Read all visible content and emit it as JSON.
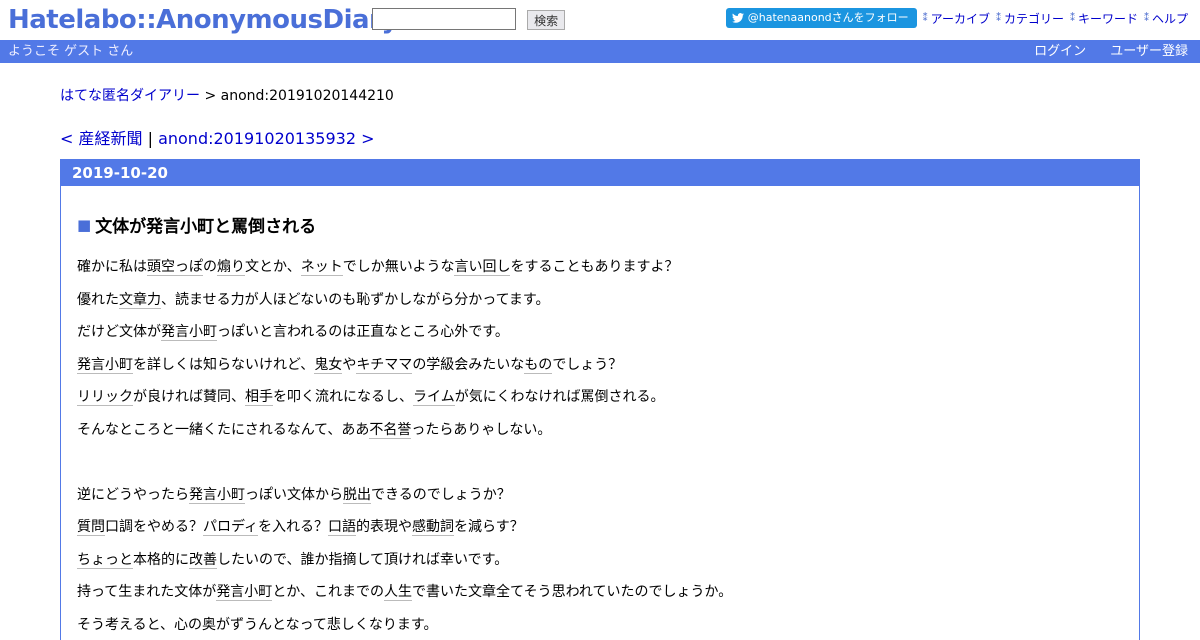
{
  "header": {
    "logo": "Hatelabo::AnonymousDiary",
    "search": {
      "placeholder": "",
      "value": "",
      "button_label": "検索"
    },
    "twitter_follow": "@hatenaanondさんをフォロー",
    "nav": [
      "アーカイブ",
      "カテゴリー",
      "キーワード",
      "ヘルプ"
    ]
  },
  "bar": {
    "welcome": "ようこそ ゲスト さん",
    "login": "ログイン",
    "register": "ユーザー登録"
  },
  "breadcrumb": {
    "root": "はてな匿名ダイアリー",
    "separator": " > ",
    "current": "anond:20191020144210"
  },
  "prevnext": {
    "prev": "< 産経新聞",
    "separator": " | ",
    "next": "anond:20191020135932 >"
  },
  "day": {
    "date": "2019-10-20",
    "entry_marker": "■",
    "title": "文体が発言小町と罵倒される",
    "lines": [
      [
        {
          "t": "確かに私は"
        },
        {
          "t": "頭",
          "k": 1
        },
        {
          "t": "空っぽ",
          "k": 1
        },
        {
          "t": "の"
        },
        {
          "t": "煽り",
          "k": 1
        },
        {
          "t": "文とか、"
        },
        {
          "t": "ネット",
          "k": 1
        },
        {
          "t": "でしか無いような"
        },
        {
          "t": "言い回し",
          "k": 1
        },
        {
          "t": "をすることもありますよ？"
        }
      ],
      [
        {
          "t": "優れた"
        },
        {
          "t": "文章力",
          "k": 1
        },
        {
          "t": "、読ませる力が人ほどないのも恥ずかしながら分かってます。"
        }
      ],
      [
        {
          "t": "だけど文体が"
        },
        {
          "t": "発言小町",
          "k": 1
        },
        {
          "t": "っぽいと言われるのは正直なところ心外です。"
        }
      ],
      [
        {
          "t": "発言小町",
          "k": 1
        },
        {
          "t": "を詳しくは知らないけれど、"
        },
        {
          "t": "鬼女",
          "k": 1
        },
        {
          "t": "や"
        },
        {
          "t": "キチママ",
          "k": 1
        },
        {
          "t": "の学級会みたいな"
        },
        {
          "t": "もの",
          "k": 1
        },
        {
          "t": "でしょう？"
        }
      ],
      [
        {
          "t": "リリック",
          "k": 1
        },
        {
          "t": "が良ければ賛同、"
        },
        {
          "t": "相手",
          "k": 1
        },
        {
          "t": "を叩く流れになるし、"
        },
        {
          "t": "ライム",
          "k": 1
        },
        {
          "t": "が気にくわなければ罵倒される。"
        }
      ],
      [
        {
          "t": "そんなところと一緒くたにされるなんて、ああ"
        },
        {
          "t": "不名誉",
          "k": 1
        },
        {
          "t": "ったらありゃしない。"
        }
      ],
      [],
      [
        {
          "t": "逆にどうやったら"
        },
        {
          "t": "発言小町",
          "k": 1
        },
        {
          "t": "っぽい文体から"
        },
        {
          "t": "脱出",
          "k": 1
        },
        {
          "t": "できるのでしょうか？"
        }
      ],
      [
        {
          "t": "質問",
          "k": 1
        },
        {
          "t": "口調をやめる？"
        },
        {
          "t": "パロディ",
          "k": 1
        },
        {
          "t": "を入れる？"
        },
        {
          "t": "口語",
          "k": 1
        },
        {
          "t": "的表現や"
        },
        {
          "t": "感動詞",
          "k": 1
        },
        {
          "t": "を減らす？"
        }
      ],
      [
        {
          "t": "ちょっと",
          "k": 1
        },
        {
          "t": "本格的に"
        },
        {
          "t": "改善",
          "k": 1
        },
        {
          "t": "したいので、誰か指摘して頂ければ幸いです。"
        }
      ],
      [
        {
          "t": "持って生まれた文体が"
        },
        {
          "t": "発言小町",
          "k": 1
        },
        {
          "t": "とか、これまでの"
        },
        {
          "t": "人生",
          "k": 1
        },
        {
          "t": "で書いた文章全てそう思われていたのでしょうか。"
        }
      ],
      [
        {
          "t": "そう考えると、心の奥がずうんとなって悲しくなります。"
        }
      ]
    ]
  },
  "colors": {
    "accent": "#5279e7",
    "link": "#0000cc",
    "twitter": "#1b95e0"
  }
}
